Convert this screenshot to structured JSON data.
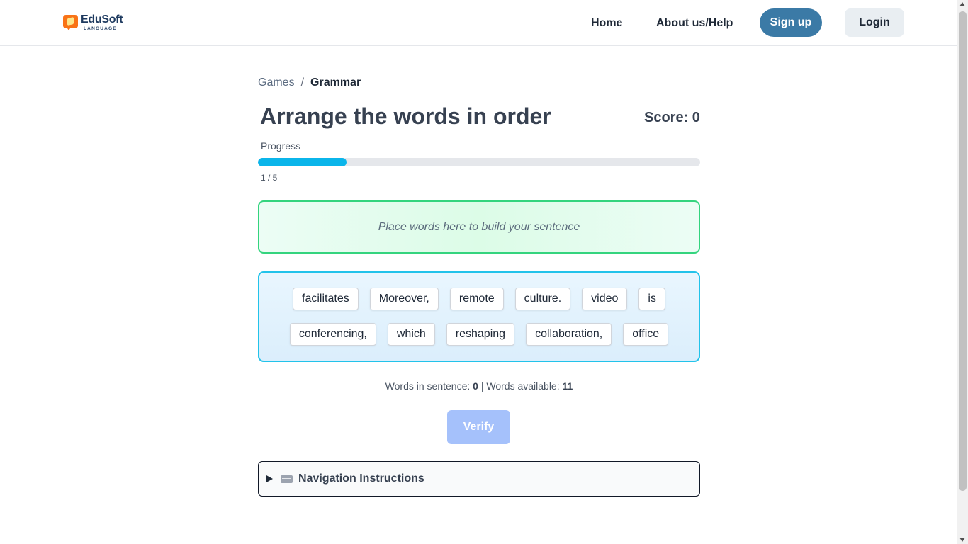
{
  "header": {
    "logo_name": "EduSoft",
    "logo_sub": "LANGUAGE",
    "nav": {
      "home": "Home",
      "about": "About us/Help"
    },
    "signup_label": "Sign up",
    "login_label": "Login"
  },
  "breadcrumb": {
    "parent": "Games",
    "separator": "/",
    "current": "Grammar"
  },
  "game": {
    "title": "Arrange the words in order",
    "score_label": "Score: 0",
    "progress": {
      "label": "Progress",
      "current": 1,
      "total": 5,
      "text": "1 / 5",
      "fraction": 0.2
    },
    "dropzone_placeholder": "Place words here to build your sentence",
    "word_rows": [
      [
        "facilitates",
        "Moreover,",
        "remote",
        "culture.",
        "video",
        "is"
      ],
      [
        "conferencing,",
        "which",
        "reshaping",
        "collaboration,",
        "office"
      ]
    ],
    "stats": {
      "in_sentence_label": "Words in sentence:",
      "in_sentence_value": "0",
      "divider": "|",
      "available_label": "Words available:",
      "available_value": "11"
    },
    "verify_label": "Verify",
    "navigation_instructions": "Navigation Instructions"
  },
  "colors": {
    "accent": "#0bb5ea",
    "signup": "#3b7aa6",
    "verify_disabled": "#a5c1fb",
    "dropzone_border": "#34d47e",
    "wordbank_border": "#22c3ea"
  },
  "icons": {
    "logo": "edusoft-logo-icon",
    "expander": "triangle-right-icon",
    "keyboard": "keyboard-icon"
  }
}
